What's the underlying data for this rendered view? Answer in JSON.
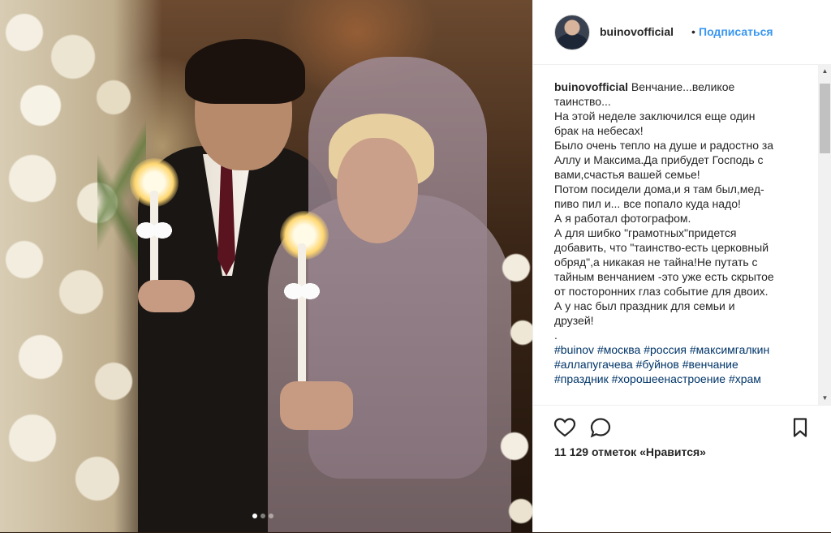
{
  "post": {
    "username": "buinovofficial",
    "separator": "•",
    "follow_label": "Подписаться",
    "caption_lines": [
      {
        "user": "buinovofficial",
        "text": " Венчание...великое"
      },
      {
        "text": "таинство..."
      },
      {
        "text": "На этой неделе заключился еще один"
      },
      {
        "text": "брак на небесах!"
      },
      {
        "text": "Было очень тепло на душе и радостно за"
      },
      {
        "text": "Аллу и Максима.Да прибудет Господь с"
      },
      {
        "text": "вами,счастья вашей семье!"
      },
      {
        "text": "Потом посидели дома,и я там был,мед-"
      },
      {
        "text": "пиво пил и... все попало куда надо!"
      },
      {
        "text": "А я работал фотографом."
      },
      {
        "text": "А для шибко \"грамотных\"придется"
      },
      {
        "text": "добавить, что \"таинство-есть церковный"
      },
      {
        "text": "обряд\",а никакая не тайна!Не путать с"
      },
      {
        "text": "тайным венчанием -это уже есть скрытое"
      },
      {
        "text": "от посторонних глаз событие для двоих."
      },
      {
        "text": "А у нас был праздник для семьи и"
      },
      {
        "text": "друзей!"
      },
      {
        "text": "."
      }
    ],
    "hashtag_lines": [
      [
        "#buinov",
        "#москва",
        "#россия",
        "#максимгалкин"
      ],
      [
        "#аллапугачева",
        "#буйнов",
        "#венчание"
      ],
      [
        "#праздник",
        "#хорошеенастроение",
        "#храм"
      ]
    ],
    "likes_text": "11 129 отметок «Нравится»",
    "carousel": {
      "total": 3,
      "active": 0
    }
  },
  "icons": {
    "like": "heart-icon",
    "comment": "comment-icon",
    "save": "bookmark-icon",
    "scroll_up": "▲",
    "scroll_down": "▼"
  },
  "colors": {
    "link": "#3897f0",
    "hashtag": "#003569",
    "text": "#262626"
  }
}
